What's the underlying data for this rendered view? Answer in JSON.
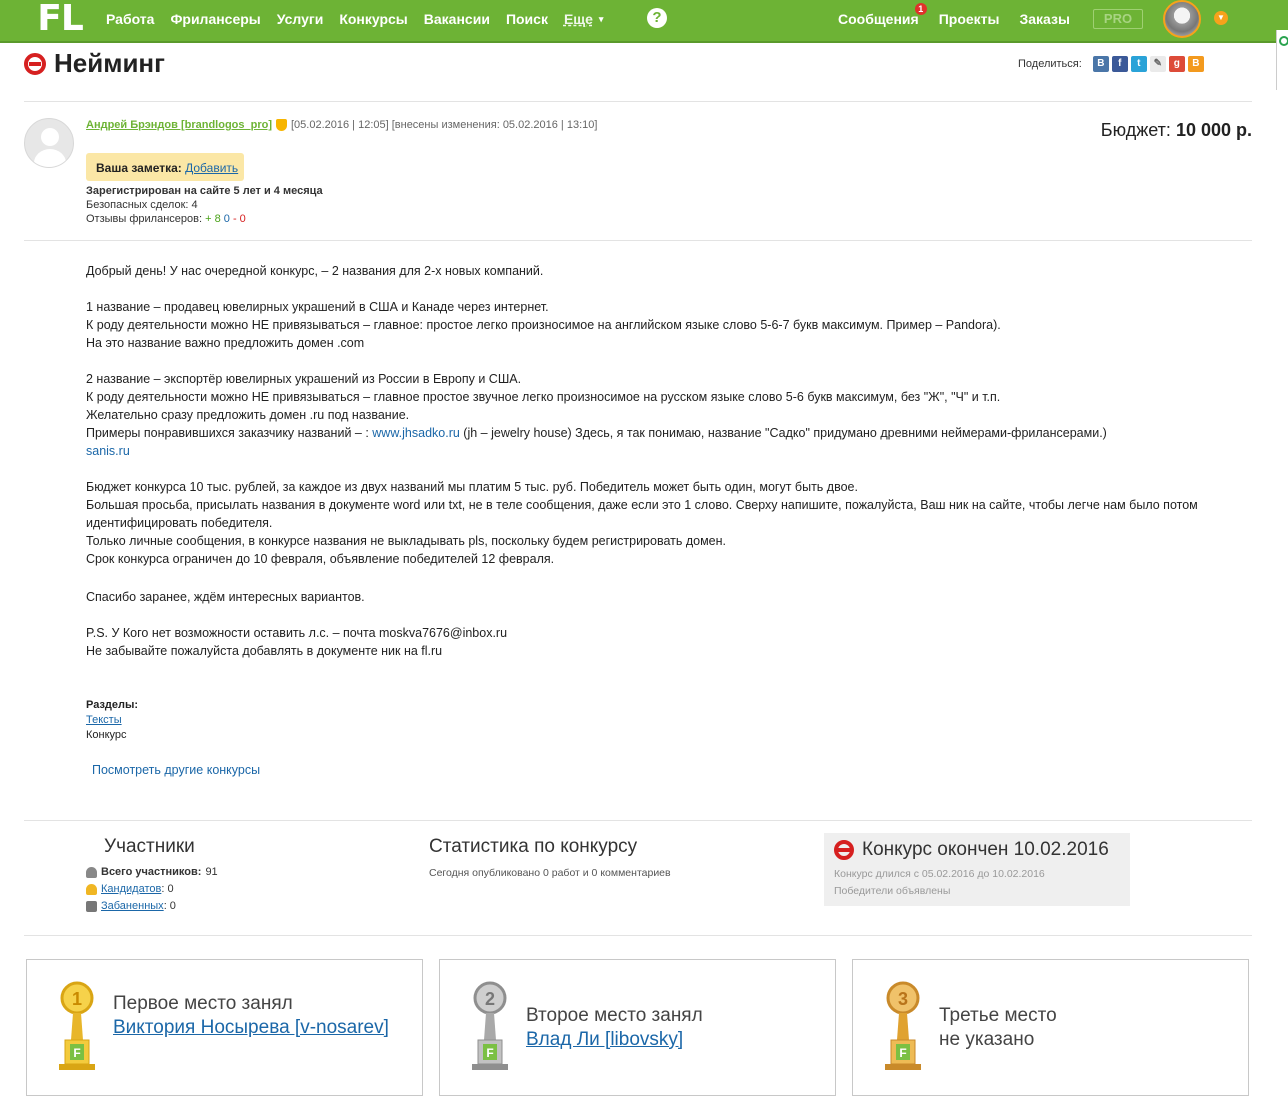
{
  "nav": {
    "logo": "FL",
    "items": [
      "Работа",
      "Фрилансеры",
      "Услуги",
      "Конкурсы",
      "Вакансии",
      "Поиск"
    ],
    "more": "Еще",
    "help": "?",
    "right": [
      "Сообщения",
      "Проекты",
      "Заказы"
    ],
    "messages_badge": "1",
    "pro": "PRO"
  },
  "page": {
    "title": "Нейминг",
    "share_label": "Поделиться:"
  },
  "author": {
    "name": "Андрей Брэндов [brandlogos_pro]",
    "date": "[05.02.2016 | 12:05] [внесены изменения: 05.02.2016 | 13:10]",
    "note_label": "Ваша заметка:",
    "note_add": "Добавить",
    "registered": "Зарегистрирован на сайте 5 лет и 4 месяца",
    "safe_deals": "Безопасных сделок: 4",
    "reviews_label": "Отзывы фрилансеров:",
    "reviews_pos": "+ 8",
    "reviews_neu": "0",
    "reviews_neg": "- 0"
  },
  "budget": {
    "label": "Бюджет:",
    "value": "10 000 р."
  },
  "body": {
    "l1": "Добрый день! У нас очередной конкурс, – 2 названия для 2-х новых компаний.",
    "l2": "1 название – продавец ювелирных украшений в США и Канаде через интернет.",
    "l3": "К роду деятельности можно НЕ привязываться – главное: простое легко произносимое на английском языке слово 5-6-7 букв максимум. Пример – Pandora).",
    "l4": "На это название важно предложить домен .com",
    "l5": "2 название – экспортёр ювелирных украшений из России в Европу и США.",
    "l6": "К роду деятельности можно НЕ привязываться – главное простое звучное легко произносимое на русском языке слово 5-6 букв максимум, без \"Ж\", \"Ч\" и т.п.",
    "l7": "Желательно сразу предложить домен .ru под название.",
    "l8a": "Примеры понравившихся заказчику названий – : ",
    "l8link": "www.jhsadko.ru",
    "l8b": " (jh – jewelry house) Здесь, я так понимаю, название \"Садко\" придумано древними неймерами-фрилансерами.)",
    "l9": "sanis.ru",
    "l10": "Бюджет конкурса 10 тыс. рублей, за каждое из двух названий мы платим 5 тыс. руб. Победитель может быть один, могут быть двое.",
    "l11": "Большая просьба, присылать названия в документе word или txt, не в теле сообщения, даже если это 1 слово. Сверху напишите, пожалуйста, Ваш ник на сайте, чтобы легче нам было потом идентифицировать победителя.",
    "l12": "Только личные сообщения, в конкурсе названия не выкладывать pls, поскольку будем регистрировать домен.",
    "l13": "Срок конкурса ограничен до 10 февраля, объявление победителей 12 февраля.",
    "l14": "Спасибо заранее, ждём интересных вариантов.",
    "l15": "P.S. У Кого нет возможности оставить л.с. – почта moskva7676@inbox.ru",
    "l16": "Не забывайте пожалуйста добавлять в документе ник на fl.ru"
  },
  "sections": {
    "label": "Разделы:",
    "link": "Тексты",
    "sub": "Конкурс"
  },
  "other_link": "Посмотреть другие конкурсы",
  "participants": {
    "title": "Участники",
    "total_label": "Всего участников:",
    "total": "91",
    "candidates_label": "Кандидатов",
    "candidates": ": 0",
    "banned_label": "Забаненных",
    "banned": ": 0"
  },
  "stats": {
    "title": "Статистика по конкурсу",
    "sub": "Сегодня опубликовано 0 работ и 0 комментариев"
  },
  "finished": {
    "title": "Конкурс окончен 10.02.2016",
    "duration": "Конкурс длился с 05.02.2016 до 10.02.2016",
    "winners": "Победители объявлены"
  },
  "winners": [
    {
      "place": "Первое место занял",
      "name": "Виктория Носырева [v-nosarev]",
      "num": "1"
    },
    {
      "place": "Второе место занял",
      "name": "Влад Ли [libovsky]",
      "num": "2"
    },
    {
      "place": "Третье место",
      "name": "не указано",
      "num": "3"
    }
  ],
  "colors": {
    "brand": "#6db335",
    "link": "#1b67a8",
    "gold": "#f0b623",
    "silver": "#9a9a9a",
    "bronze": "#e0a230"
  }
}
